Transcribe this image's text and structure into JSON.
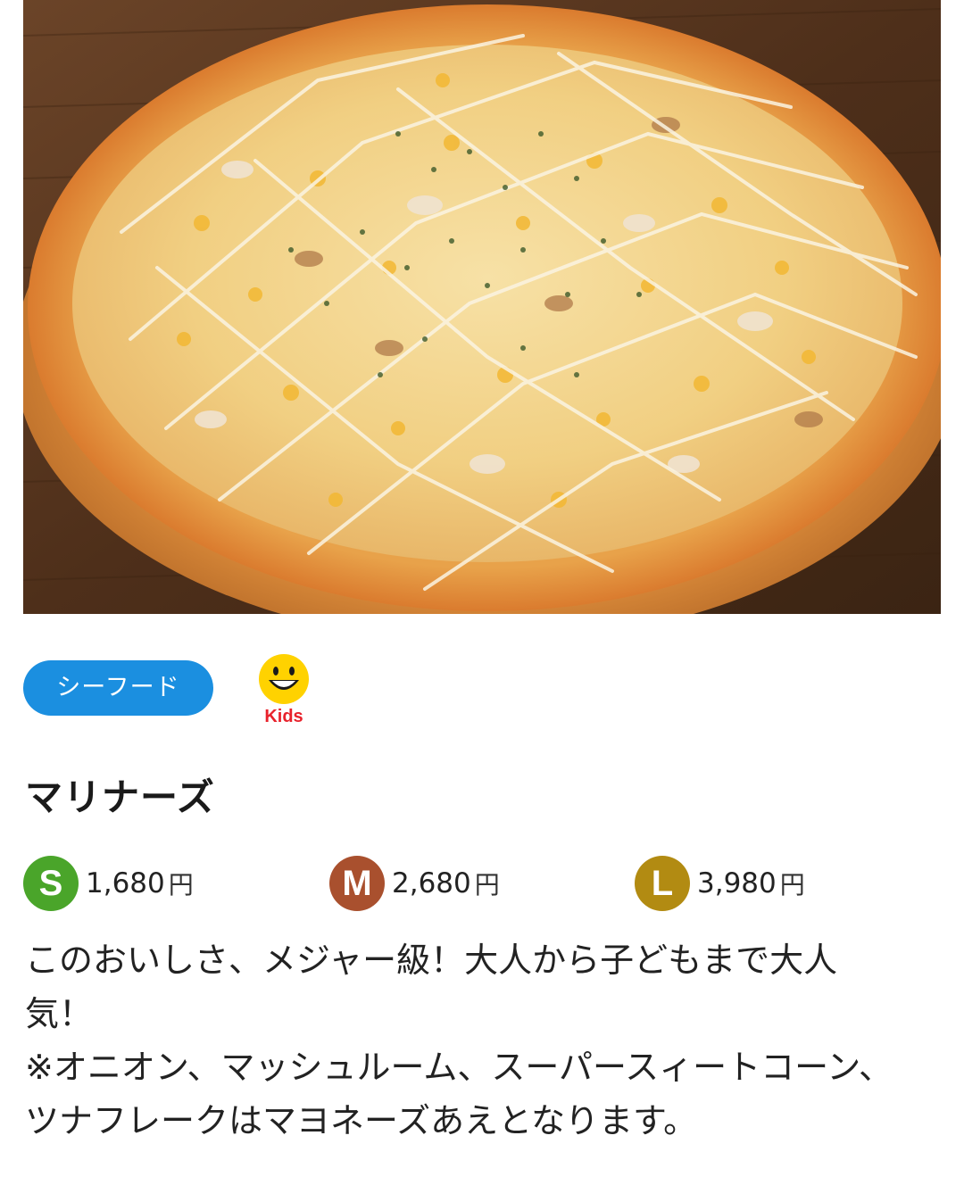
{
  "hero": {
    "image_name": "pizza-photo"
  },
  "category": {
    "label": "シーフード",
    "color": "#1b8fe0"
  },
  "kids": {
    "label": "Kids",
    "icon": "smiley-face-icon",
    "face_color": "#ffd200",
    "label_color": "#e8222c"
  },
  "product": {
    "name": "マリナーズ"
  },
  "prices": [
    {
      "size": "S",
      "price": "1,680",
      "unit": "円",
      "color": "#4aa52a"
    },
    {
      "size": "M",
      "price": "2,680",
      "unit": "円",
      "color": "#a9502e"
    },
    {
      "size": "L",
      "price": "3,980",
      "unit": "円",
      "color": "#b28b12"
    }
  ],
  "description": {
    "line1": "このおいしさ、メジャー級！大人から子どもまで大人気！",
    "line2": "※オニオン、マッシュルーム、スーパースィートコーン、ツナフレークはマヨネーズあえとなります。"
  }
}
